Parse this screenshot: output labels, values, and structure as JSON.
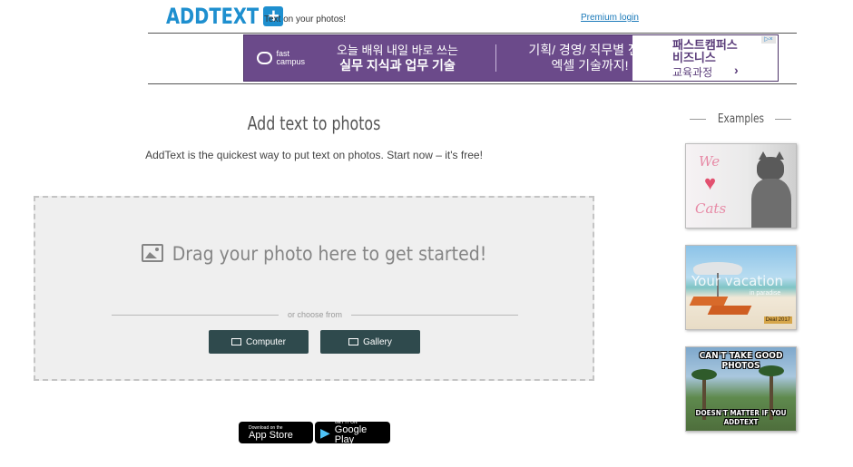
{
  "header": {
    "logo_text": "ADDTEXT",
    "logo_plus": "+",
    "tagline": "Text on your photos!",
    "premium_login": "Premium login"
  },
  "ad": {
    "brand": "fast campus",
    "line1": "오늘 배워 내일 바로 쓰는",
    "line2": "실무 지식과 업무 기술",
    "mid_line1": "기획/ 경영/ 직무별 전략",
    "mid_line2": "엑셀 기술까지!",
    "right_line1": "패스트캠퍼스",
    "right_line2": "비즈니스",
    "right_line3": "교육과정",
    "right_arrow": "›"
  },
  "main": {
    "title": "Add text to photos",
    "subtitle": "AddText is the quickest way to put text on photos. Start now – it's free!",
    "drop_text": "Drag your photo here to get started!",
    "or_choose": "or choose from",
    "buttons": {
      "computer": "Computer",
      "gallery": "Gallery"
    }
  },
  "stores": {
    "appstore_small": "Download on the",
    "appstore_big": "App Store",
    "google_small": "GET IT ON",
    "google_big": "Google Play"
  },
  "examples": {
    "heading": "Examples",
    "ex1": {
      "top": "We",
      "heart": "♥",
      "bottom": "Cats"
    },
    "ex2": {
      "main": "Your vacation",
      "sub": "in paradise",
      "tag": "Deal 2017"
    },
    "ex3": {
      "top": "CAN'T TAKE GOOD PHOTOS",
      "bottom_line1": "DOESN'T MATTER IF YOU",
      "bottom_line2": "ADDTEXT"
    }
  },
  "colors": {
    "brand_blue": "#1e8fcf",
    "button_dark": "#2f4a4d",
    "ad_purple": "#6b4a8a",
    "dropzone_bg": "#efefef"
  }
}
